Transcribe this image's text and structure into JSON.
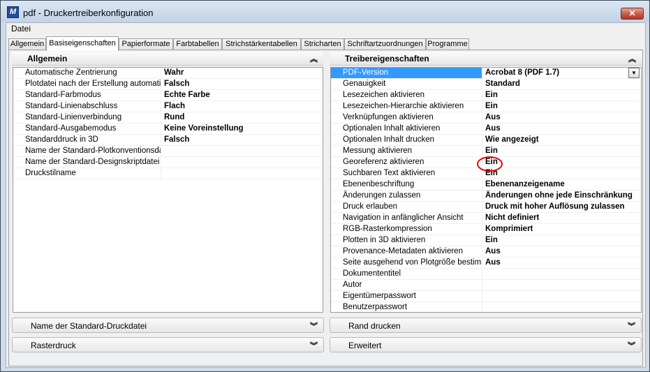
{
  "window": {
    "title": "pdf - Druckertreiberkonfiguration",
    "close_label": "✕"
  },
  "menu": {
    "datei": "Datei"
  },
  "tabs": [
    "Allgemein",
    "Basiseigenschaften",
    "Papierformate",
    "Farbtabellen",
    "Strichstärkentabellen",
    "Stricharten",
    "Schriftartzuordnungen",
    "Programme"
  ],
  "allgemein": {
    "title": "Allgemein",
    "rows": [
      {
        "name": "Automatische Zentrierung",
        "value": "Wahr"
      },
      {
        "name": "Plotdatei nach der Erstellung automatis",
        "value": "Falsch"
      },
      {
        "name": "Standard-Farbmodus",
        "value": "Echte Farbe"
      },
      {
        "name": "Standard-Linienabschluss",
        "value": "Flach"
      },
      {
        "name": "Standard-Linienverbindung",
        "value": "Rund"
      },
      {
        "name": "Standard-Ausgabemodus",
        "value": "Keine Voreinstellung"
      },
      {
        "name": "Standarddruck in 3D",
        "value": "Falsch"
      },
      {
        "name": "Name der Standard-Plotkonventionsdat",
        "value": ""
      },
      {
        "name": "Name der Standard-Designskriptdatei",
        "value": ""
      },
      {
        "name": "Druckstilname",
        "value": ""
      }
    ]
  },
  "treiber": {
    "title": "Treibereigenschaften",
    "rows": [
      {
        "name": "PDF-Version",
        "value": "Acrobat 8 (PDF 1.7)"
      },
      {
        "name": "Genauigkeit",
        "value": "Standard"
      },
      {
        "name": "Lesezeichen aktivieren",
        "value": "Ein"
      },
      {
        "name": "Lesezeichen-Hierarchie aktivieren",
        "value": "Ein"
      },
      {
        "name": "Verknüpfungen aktivieren",
        "value": "Aus"
      },
      {
        "name": "Optionalen Inhalt aktivieren",
        "value": "Aus"
      },
      {
        "name": "Optionalen Inhalt drucken",
        "value": "Wie angezeigt"
      },
      {
        "name": "Messung aktivieren",
        "value": "Ein"
      },
      {
        "name": "Georeferenz aktivieren",
        "value": "Ein"
      },
      {
        "name": "Suchbaren Text aktivieren",
        "value": "Ein"
      },
      {
        "name": "Ebenenbeschriftung",
        "value": "Ebenenanzeigename"
      },
      {
        "name": "Änderungen zulassen",
        "value": "Änderungen ohne jede Einschränkung"
      },
      {
        "name": "Druck erlauben",
        "value": "Druck mit hoher Auflösung zulassen"
      },
      {
        "name": "Navigation in anfänglicher Ansicht",
        "value": "Nicht definiert"
      },
      {
        "name": "RGB-Rasterkompression",
        "value": "Komprimiert"
      },
      {
        "name": "Plotten in 3D aktivieren",
        "value": "Ein"
      },
      {
        "name": "Provenance-Metadaten aktivieren",
        "value": "Aus"
      },
      {
        "name": "Seite ausgehend von Plotgröße bestimm",
        "value": "Aus"
      },
      {
        "name": "Dokumententitel",
        "value": ""
      },
      {
        "name": "Autor",
        "value": ""
      },
      {
        "name": "Eigentümerpasswort",
        "value": ""
      },
      {
        "name": "Benutzerpasswort",
        "value": ""
      }
    ]
  },
  "sections": {
    "standard_druckdatei": "Name der Standard-Druckdatei",
    "rand_drucken": "Rand drucken",
    "rasterdruck": "Rasterdruck",
    "erweitert": "Erweitert"
  },
  "icons": {
    "collapse": "chevron-up-icon",
    "expand": "chevron-down-icon",
    "dropdown": "dropdown-arrow-icon",
    "app": "microstation-icon"
  },
  "colors": {
    "selection": "#3399ff",
    "highlight_circle": "#e00000"
  }
}
